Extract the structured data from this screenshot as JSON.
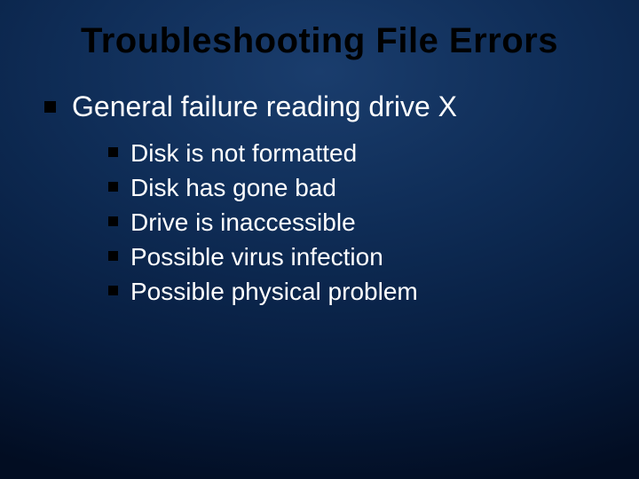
{
  "slide": {
    "title": "Troubleshooting File Errors",
    "level1": {
      "text": "General failure reading drive X"
    },
    "level2": [
      {
        "text": "Disk is not formatted"
      },
      {
        "text": "Disk has gone bad"
      },
      {
        "text": "Drive is inaccessible"
      },
      {
        "text": "Possible virus infection"
      },
      {
        "text": "Possible physical problem"
      }
    ]
  }
}
